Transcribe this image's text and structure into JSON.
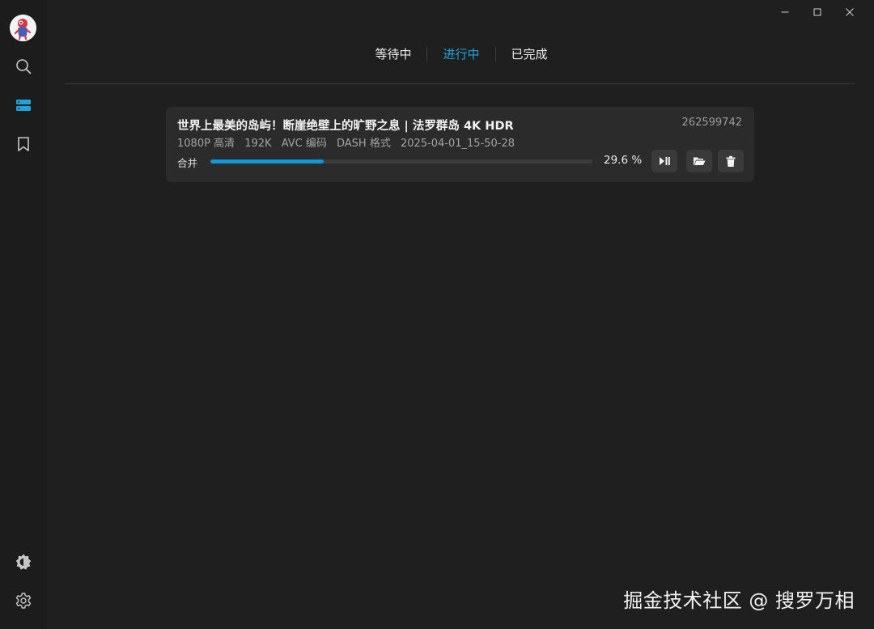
{
  "sidebar": {
    "items": [
      {
        "icon": "search-icon"
      },
      {
        "icon": "download-list-icon",
        "active": true
      },
      {
        "icon": "bookmark-icon"
      }
    ],
    "bottom": [
      {
        "icon": "theme-icon"
      },
      {
        "icon": "settings-icon"
      }
    ],
    "accent_color": "#1fa3d8"
  },
  "tabs": [
    {
      "label": "等待中"
    },
    {
      "label": "进行中",
      "active": true
    },
    {
      "label": "已完成"
    }
  ],
  "task": {
    "title": "世界上最美的岛屿！断崖绝壁上的旷野之息 | 法罗群岛 4K HDR",
    "id": "262599742",
    "meta": {
      "resolution": "1080P 高清",
      "bitrate": "192K",
      "codec": "AVC 编码",
      "format": "DASH 格式",
      "timestamp": "2025-04-01_15-50-28"
    },
    "status": "合并",
    "progress": 29.6,
    "progress_text": "29.6 %",
    "progress_color": "#1296d6"
  },
  "watermark": "掘金技术社区 @ 搜罗万相"
}
